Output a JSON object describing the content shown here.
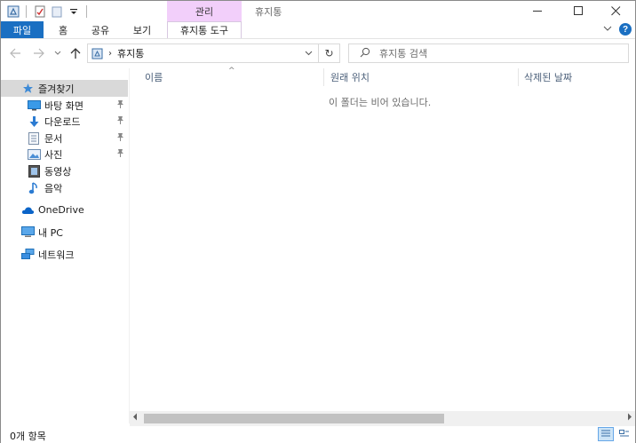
{
  "window": {
    "title": "휴지통",
    "context_tab": "관리"
  },
  "ribbon": {
    "tabs": [
      "파일",
      "홈",
      "공유",
      "보기",
      "휴지통 도구"
    ],
    "help": "?"
  },
  "address": {
    "location": "휴지통",
    "separator": "›",
    "refresh": "↻"
  },
  "search": {
    "placeholder": "휴지통 검색"
  },
  "sidebar": {
    "quick_access": "즐겨찾기",
    "items": [
      {
        "label": "바탕 화면",
        "icon": "desktop-icon",
        "pinned": true
      },
      {
        "label": "다운로드",
        "icon": "download-icon",
        "pinned": true
      },
      {
        "label": "문서",
        "icon": "document-icon",
        "pinned": true
      },
      {
        "label": "사진",
        "icon": "pictures-icon",
        "pinned": true
      },
      {
        "label": "동영상",
        "icon": "video-icon",
        "pinned": false
      },
      {
        "label": "음악",
        "icon": "music-icon",
        "pinned": false
      }
    ],
    "onedrive": "OneDrive",
    "this_pc": "내 PC",
    "network": "네트워크"
  },
  "columns": {
    "name": "이름",
    "original_location": "원래 위치",
    "date_deleted": "삭제된 날짜"
  },
  "content": {
    "empty_message": "이 폴더는 비어 있습니다."
  },
  "status": {
    "item_count": "0개 항목"
  },
  "colors": {
    "accent": "#1a6fc2",
    "context_tab": "#f2cffa",
    "selection": "#d9d9d9",
    "column_header_text": "#4c607a"
  }
}
